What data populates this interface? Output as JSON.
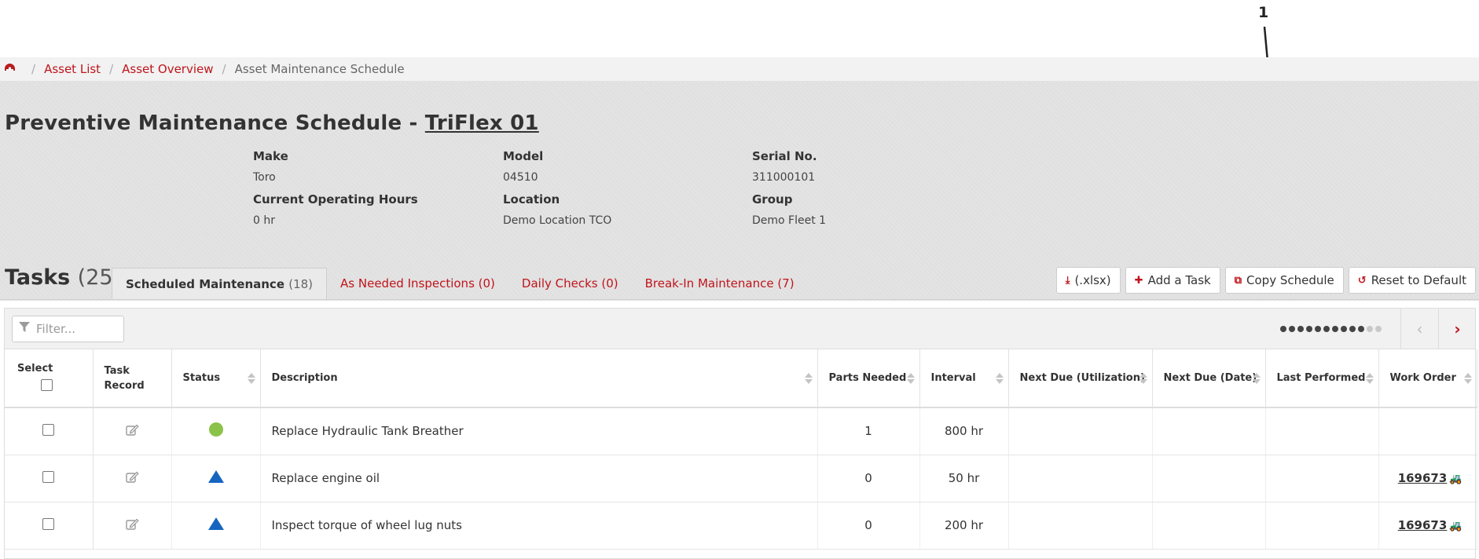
{
  "callout": {
    "label": "1"
  },
  "breadcrumb": {
    "home_icon": "dashboard-icon",
    "items": [
      "Asset List",
      "Asset Overview"
    ],
    "current": "Asset Maintenance Schedule"
  },
  "title": {
    "prefix": "Preventive Maintenance Schedule - ",
    "asset": "TriFlex 01"
  },
  "asset_info": {
    "make_label": "Make",
    "make": "Toro",
    "model_label": "Model",
    "model": "04510",
    "serial_label": "Serial No.",
    "serial": "311000101",
    "hours_label": "Current Operating Hours",
    "hours": "0 hr",
    "location_label": "Location",
    "location": "Demo Location TCO",
    "group_label": "Group",
    "group": "Demo Fleet 1"
  },
  "tasks": {
    "label": "Tasks",
    "count": "(25)",
    "tabs": [
      {
        "label": "Scheduled Maintenance",
        "count": "(18)"
      },
      {
        "label": "As Needed Inspections (0)"
      },
      {
        "label": "Daily Checks (0)"
      },
      {
        "label": "Break-In Maintenance (7)"
      }
    ]
  },
  "actions": {
    "export": "(.xlsx)",
    "add": "Add a Task",
    "copy": "Copy Schedule",
    "reset": "Reset to Default"
  },
  "toolbar": {
    "filter_placeholder": "Filter...",
    "pages_total": 12,
    "pages_dark": 10
  },
  "columns": {
    "select": "Select",
    "task_record": "Task Record",
    "status": "Status",
    "description": "Description",
    "parts": "Parts Needed",
    "interval": "Interval",
    "next_util": "Next Due (Utilization)",
    "next_date": "Next Due (Date)",
    "last": "Last Performed",
    "wo": "Work Order"
  },
  "rows": [
    {
      "status": "green-circle",
      "description": "Replace Hydraulic Tank Breather",
      "parts": "1",
      "interval": "800 hr",
      "next_util": "",
      "next_date": "",
      "last": "",
      "wo": ""
    },
    {
      "status": "blue-triangle",
      "description": "Replace engine oil",
      "parts": "0",
      "interval": "50 hr",
      "next_util": "",
      "next_date": "",
      "last": "",
      "wo": "169673"
    },
    {
      "status": "blue-triangle",
      "description": "Inspect torque of wheel lug nuts",
      "parts": "0",
      "interval": "200 hr",
      "next_util": "",
      "next_date": "",
      "last": "",
      "wo": "169673"
    }
  ],
  "colors": {
    "accent": "#c0141b",
    "status_green": "#8bc34a",
    "status_blue": "#1565c0"
  }
}
